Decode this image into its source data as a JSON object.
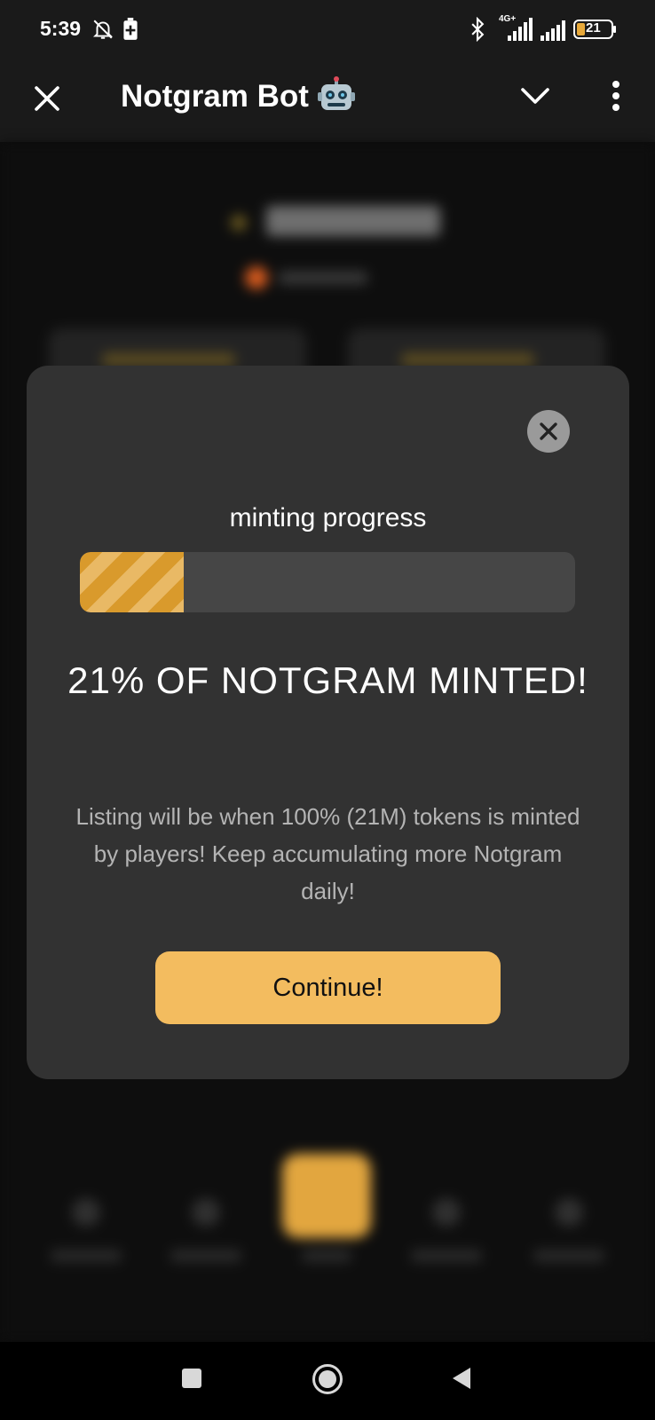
{
  "status_bar": {
    "time": "5:39",
    "network_type": "4G+",
    "battery_level": "21"
  },
  "header": {
    "title": "Notgram Bot",
    "title_emoji_icon": "robot-face-icon"
  },
  "modal": {
    "progress_label": "minting progress",
    "progress_percent": 21,
    "heading": "21% OF NOTGRAM MINTED!",
    "description": "Listing will be when 100% (21M) tokens is minted by players! Keep accumulating more Notgram daily!",
    "continue_label": "Continue!"
  },
  "colors": {
    "accent": "#f3bc5f",
    "progress_stripe_dark": "#d99a2c",
    "progress_stripe_light": "#e9b965",
    "modal_bg": "#323232"
  }
}
